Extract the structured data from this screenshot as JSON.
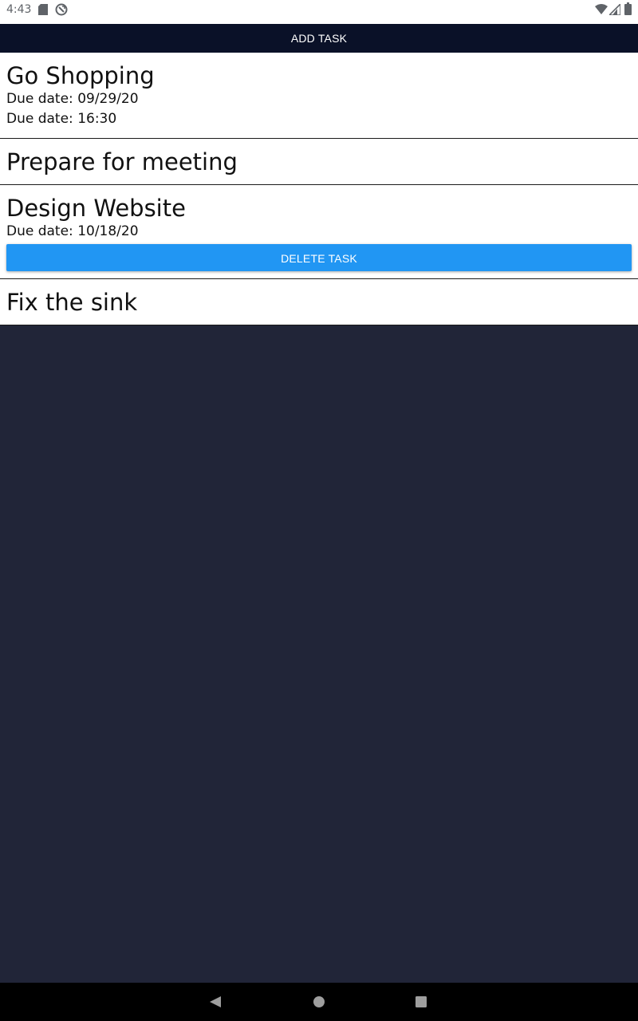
{
  "status_bar": {
    "time": "4:43",
    "icons": [
      "sd-card-icon",
      "sync-icon",
      "wifi-icon",
      "signal-icon",
      "battery-icon"
    ]
  },
  "toolbar": {
    "add_task_label": "ADD TASK"
  },
  "tasks": [
    {
      "title": "Go Shopping",
      "due_date": "Due date: 09/29/20",
      "due_time": "Due date: 16:30"
    },
    {
      "title": "Prepare for meeting"
    },
    {
      "title": "Design Website",
      "due_date": "Due date: 10/18/20",
      "delete_label": "DELETE TASK"
    },
    {
      "title": "Fix the sink"
    }
  ],
  "nav_bar": {
    "icons": [
      "back-icon",
      "home-icon",
      "recents-icon"
    ]
  },
  "colors": {
    "toolbar_bg": "#0a1128",
    "page_bg": "#212538",
    "delete_button": "#2196f3",
    "list_bg": "#ffffff"
  }
}
